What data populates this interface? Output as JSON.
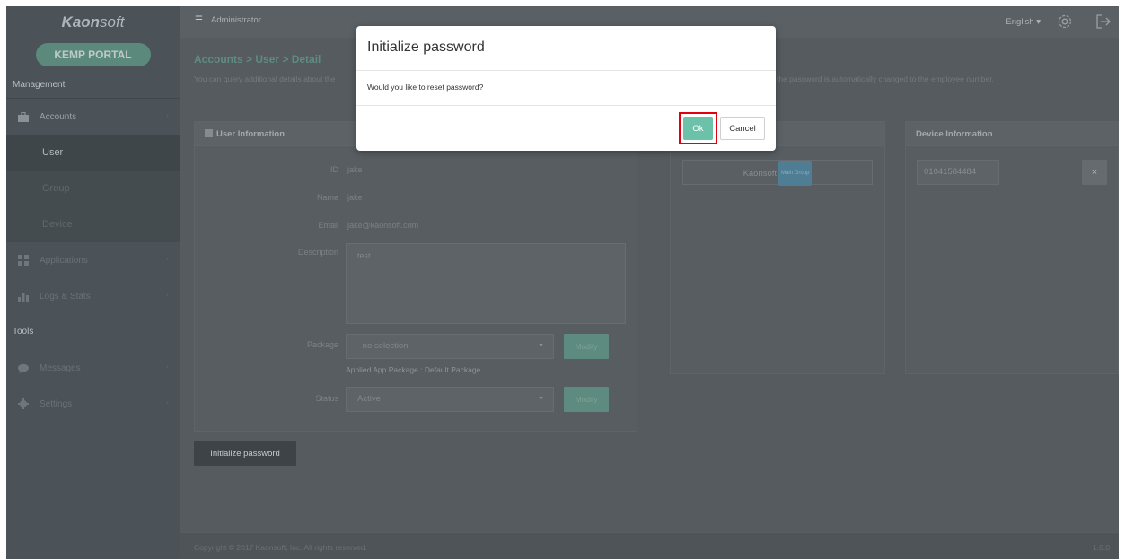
{
  "brand": {
    "logo_bold": "Kaon",
    "logo_light": "soft",
    "portal": "KEMP PORTAL"
  },
  "sidebar": {
    "management_label": "Management",
    "tools_label": "Tools",
    "items": [
      {
        "label": "Accounts",
        "icon": "briefcase-icon"
      },
      {
        "label": "Applications",
        "icon": "grid-icon"
      },
      {
        "label": "Logs & Stats",
        "icon": "bar-chart-icon"
      },
      {
        "label": "Messages",
        "icon": "chat-icon"
      },
      {
        "label": "Settings",
        "icon": "gear-icon"
      }
    ],
    "sub_items": [
      "User",
      "Group",
      "Device"
    ]
  },
  "topbar": {
    "user": "Administrator",
    "language": "English ▾"
  },
  "page": {
    "breadcrumb": "Accounts > User > Detail",
    "description_left": "You can query additional details about the",
    "description_right": "the password is automatically changed to the employee number."
  },
  "user_info": {
    "title": "User Information",
    "fields": [
      {
        "label": "ID",
        "value": "jake"
      },
      {
        "label": "Name",
        "value": "jake"
      },
      {
        "label": "Email",
        "value": "jake@kaonsoft.com"
      }
    ],
    "description_label": "Description",
    "description_value": "test",
    "package_label": "Package",
    "package_value": "- no selection -",
    "applied_package": "Applied App Package : Default Package",
    "status_label": "Status",
    "status_value": "Active",
    "modify_label": "Modify"
  },
  "group_info": {
    "group_name": "Kaonsoft",
    "badge": "Main Group"
  },
  "device_info": {
    "title": "Device Information",
    "device_number": "01041584484",
    "delete_label": "×"
  },
  "init_button": "Initialize password",
  "footer": {
    "copyright": "Copyright © 2017 Kaonsoft, Inc. All rights reserved.",
    "version": "1.0.0"
  },
  "modal": {
    "title": "Initialize password",
    "message": "Would you like to reset password?",
    "ok_label": "Ok",
    "cancel_label": "Cancel",
    "highlight_color": "#e00010",
    "ok_color": "#6bc2a9"
  }
}
